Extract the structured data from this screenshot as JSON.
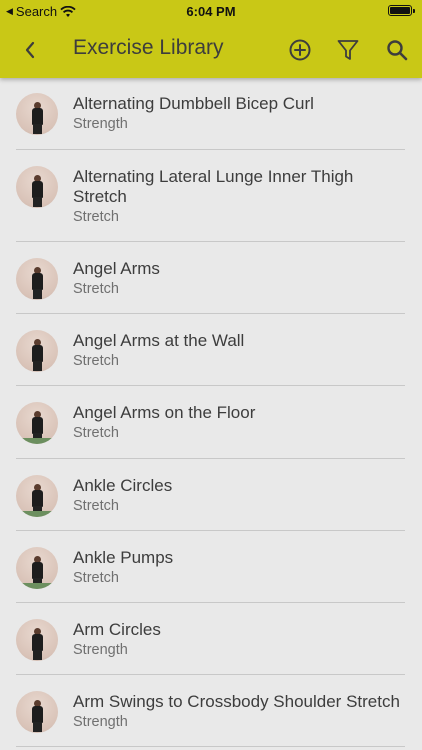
{
  "status_bar": {
    "back_app": "Search",
    "time": "6:04 PM"
  },
  "header": {
    "title": "Exercise Library",
    "accent_color": "#c9c816"
  },
  "exercises": [
    {
      "title": "Alternating Dumbbell Bicep Curl",
      "category": "Strength"
    },
    {
      "title": "Alternating Lateral Lunge Inner Thigh Stretch",
      "category": "Stretch"
    },
    {
      "title": "Angel Arms",
      "category": "Stretch"
    },
    {
      "title": "Angel Arms at the Wall",
      "category": "Stretch"
    },
    {
      "title": "Angel Arms on the Floor",
      "category": "Stretch"
    },
    {
      "title": "Ankle Circles",
      "category": "Stretch"
    },
    {
      "title": "Ankle Pumps",
      "category": "Stretch"
    },
    {
      "title": "Arm Circles",
      "category": "Strength"
    },
    {
      "title": "Arm Swings to Crossbody Shoulder Stretch",
      "category": "Strength"
    }
  ]
}
